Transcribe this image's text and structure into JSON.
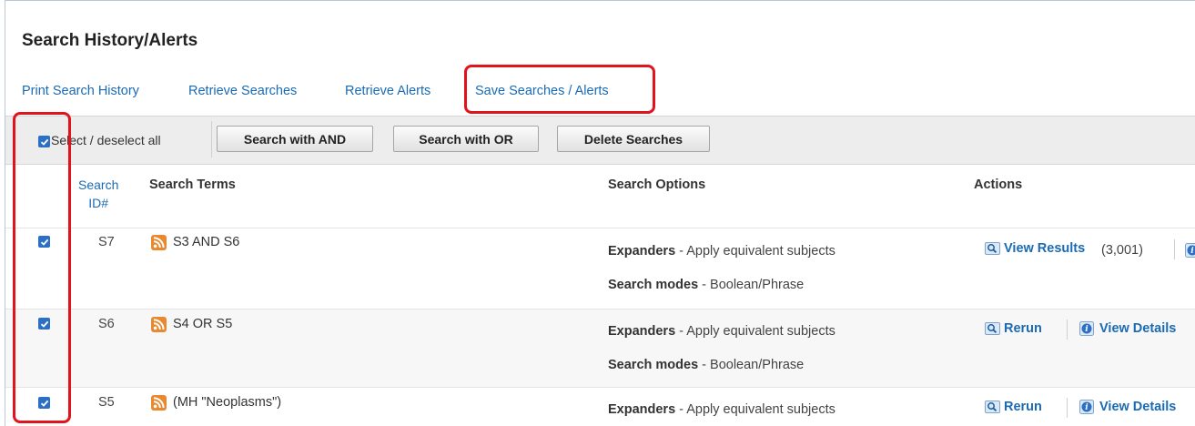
{
  "page": {
    "title": "Search History/Alerts"
  },
  "links": {
    "print": "Print Search History",
    "retrieve_searches": "Retrieve Searches",
    "retrieve_alerts": "Retrieve Alerts",
    "save": "Save Searches / Alerts"
  },
  "toolbar": {
    "select_all_label": "Select / deselect all",
    "select_all_checked": true,
    "search_and": "Search with AND",
    "search_or": "Search with OR",
    "delete": "Delete Searches"
  },
  "columns": {
    "search_id_line1": "Search",
    "search_id_line2": "ID#",
    "search_terms": "Search Terms",
    "search_options": "Search Options",
    "actions": "Actions"
  },
  "rows": [
    {
      "id": "S7",
      "checked": true,
      "terms": "S3 AND S6",
      "expanders_label": "Expanders",
      "expanders_value": " - Apply equivalent subjects",
      "modes_label": "Search modes",
      "modes_value": " - Boolean/Phrase",
      "action_primary": "View Results",
      "result_count": "(3,001)"
    },
    {
      "id": "S6",
      "checked": true,
      "terms": "S4 OR S5",
      "expanders_label": "Expanders",
      "expanders_value": " - Apply equivalent subjects",
      "modes_label": "Search modes",
      "modes_value": " - Boolean/Phrase",
      "action_primary": "Rerun",
      "action_secondary": "View Details"
    },
    {
      "id": "S5",
      "checked": true,
      "terms": "(MH \"Neoplasms\")",
      "expanders_label": "Expanders",
      "expanders_value": " - Apply equivalent subjects",
      "action_primary": "Rerun",
      "action_secondary": "View Details"
    }
  ],
  "colors": {
    "link": "#1a6bb3",
    "checkbox": "#2b6fc7",
    "rss": "#e8892f",
    "highlight": "#e0141a"
  },
  "icons": [
    "checkbox-icon",
    "rss-icon",
    "magnifier-icon",
    "info-icon"
  ]
}
